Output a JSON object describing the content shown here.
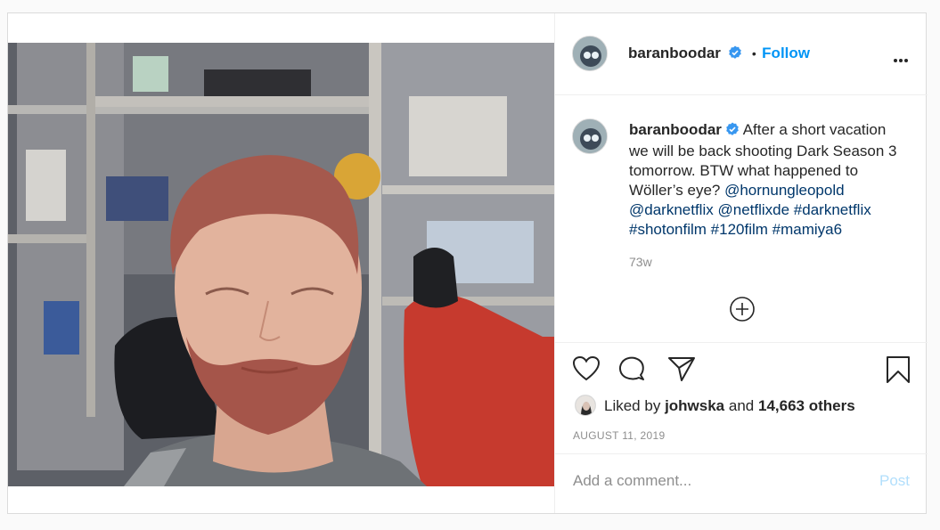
{
  "post": {
    "username": "baranboodar",
    "follow_separator": "•",
    "follow_label": "Follow",
    "caption_text": "After a short vacation we will be back shooting Dark Season 3 tomorrow. BTW what happened to Wöller’s eye?",
    "mentions": [
      "@hornungleopold",
      "@darknetflix",
      "@netflixde"
    ],
    "hashtags": [
      "#darknetflix",
      "#shotonfilm",
      "#120film",
      "#mamiya6"
    ],
    "time_ago": "73w",
    "liked_by_prefix": "Liked by",
    "liked_by_user": "johwska",
    "liked_by_and": "and",
    "liked_by_count": "14,663 others",
    "date": "AUGUST 11, 2019"
  },
  "comment": {
    "placeholder": "Add a comment...",
    "post_label": "Post"
  },
  "icons": {
    "more": "more-options-icon",
    "verified": "verified-badge-icon",
    "load_more": "plus-circle-icon",
    "like": "heart-icon",
    "comment": "comment-icon",
    "share": "paper-plane-icon",
    "save": "bookmark-icon"
  },
  "colors": {
    "accent": "#0095f6",
    "link": "#00376b",
    "muted": "#8e8e8e",
    "post_disabled": "#b2dffc"
  }
}
